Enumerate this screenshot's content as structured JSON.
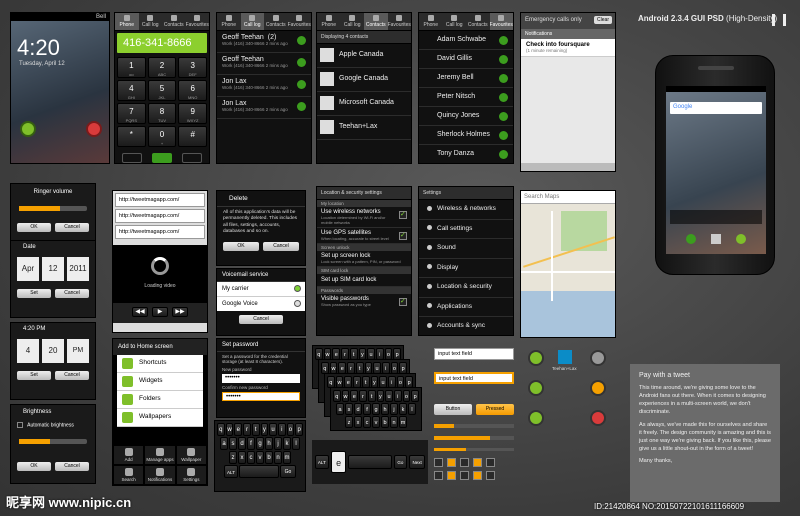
{
  "lock": {
    "carrier": "Bell",
    "time": "4:20",
    "date": "Tuesday, April 12"
  },
  "dialer": {
    "tabs": [
      "Phone",
      "Call log",
      "Contacts",
      "Favourites"
    ],
    "number": "416-341-8666",
    "keys": [
      [
        "1",
        "2",
        "3"
      ],
      [
        "4",
        "5",
        "6"
      ],
      [
        "7",
        "8",
        "9"
      ],
      [
        "*",
        "0",
        "#"
      ]
    ],
    "subs": [
      [
        "oo",
        "ABC",
        "DEF"
      ],
      [
        "GHI",
        "JKL",
        "MNO"
      ],
      [
        "PQRS",
        "TUV",
        "WXYZ"
      ],
      [
        "",
        "+",
        ""
      ]
    ]
  },
  "calllog": {
    "tabs": [
      "Phone",
      "Call log",
      "Contacts",
      "Favourites"
    ],
    "entries": [
      {
        "name": "Geoff Teehan",
        "count": "(2)",
        "detail": "Work (416) 340-8666 2 mins ago"
      },
      {
        "name": "Geoff Teehan",
        "count": "",
        "detail": "Work (416) 340-8666 2 mins ago"
      },
      {
        "name": "Jon Lax",
        "count": "",
        "detail": "Work (416) 340-8666 2 mins ago"
      },
      {
        "name": "Jon Lax",
        "count": "",
        "detail": "Work (416) 340-8666 2 mins ago"
      }
    ]
  },
  "contacts": {
    "tabs": [
      "Phone",
      "Call log",
      "Contacts",
      "Favourites"
    ],
    "header": "Displaying 4 contacts",
    "entries": [
      "Apple Canada",
      "Google Canada",
      "Microsoft Canada",
      "Teehan+Lax"
    ]
  },
  "favourites": {
    "tabs": [
      "Phone",
      "Call log",
      "Contacts",
      "Favourites"
    ],
    "entries": [
      "Adam Schwabe",
      "David Gillis",
      "Jeremy Bell",
      "Peter Nitsch",
      "Quincy Jones",
      "Sherlock Holmes",
      "Tony Danza"
    ]
  },
  "notif": {
    "bar": "Emergency calls only",
    "clear": "Clear",
    "section": "Notifications",
    "item": "Check into foursquare",
    "itemsub": "(1 minute remaining)"
  },
  "title": {
    "main": "Android 2.3.4 GUI PSD",
    "variant": "(High-Density)"
  },
  "ringer": {
    "label": "Ringer volume",
    "ok": "OK",
    "cancel": "Cancel"
  },
  "date": {
    "label": "Date",
    "month": "Apr",
    "day": "12",
    "year": "2011",
    "set": "Set",
    "cancel": "Cancel"
  },
  "time": {
    "label": "4:20 PM",
    "hour": "4",
    "minute": "20",
    "ampm": "PM",
    "set": "Set",
    "cancel": "Cancel"
  },
  "brightness": {
    "label": "Brightness",
    "auto": "Automatic brightness",
    "ok": "OK",
    "cancel": "Cancel"
  },
  "browser": {
    "url": "http://tweetmagapp.com/",
    "url2": "http://tweetmagapp.com/",
    "url3": "http://tweetmagapp.com/",
    "loading": "Loading video"
  },
  "home": {
    "title": "Add to Home screen",
    "items": [
      "Shortcuts",
      "Widgets",
      "Folders",
      "Wallpapers"
    ],
    "menu": [
      "Add",
      "Manage apps",
      "Wallpaper",
      "Search",
      "Notifications",
      "Settings"
    ]
  },
  "delete": {
    "title": "Delete",
    "body": "All of this application's data will be permanently deleted. This includes all files, settings, accounts, databases and so on.",
    "ok": "OK",
    "cancel": "Cancel"
  },
  "voicemail": {
    "title": "Voicemail service",
    "opt1": "My carrier",
    "opt2": "Google Voice",
    "cancel": "Cancel"
  },
  "password": {
    "title": "Set password",
    "body": "Set a password for the credential storage (at least 8 characters).",
    "new": "New password",
    "confirm": "Confirm new password",
    "value": "•••••••"
  },
  "location": {
    "header": "Location & security settings",
    "section": "My location",
    "items": [
      {
        "t": "Use wireless networks",
        "s": "Location determined by Wi-Fi and/or mobile networks"
      },
      {
        "t": "Use GPS satellites",
        "s": "When locating, accurate to street level"
      }
    ],
    "section2": "Screen unlock",
    "item3": "Set up screen lock",
    "item3s": "Lock screen with a pattern, PIN, or password",
    "section3": "SIM card lock",
    "item4": "Set up SIM card lock",
    "section4": "Passwords",
    "item5": "Visible passwords",
    "item5s": "Show password as you type"
  },
  "settings": {
    "header": "Settings",
    "items": [
      "Wireless & networks",
      "Call settings",
      "Sound",
      "Display",
      "Location & security",
      "Applications",
      "Accounts & sync"
    ]
  },
  "map": {
    "search": "Search Maps"
  },
  "keyboard": {
    "rows": [
      [
        "q",
        "w",
        "e",
        "r",
        "t",
        "y",
        "u",
        "i",
        "o",
        "p"
      ],
      [
        "a",
        "s",
        "d",
        "f",
        "g",
        "h",
        "j",
        "k",
        "l"
      ],
      [
        "z",
        "x",
        "c",
        "v",
        "b",
        "n",
        "m"
      ]
    ],
    "go": "Go",
    "alt": "ALT",
    "next": "Next"
  },
  "inputs": {
    "field1": "input text field",
    "field2": "input text field",
    "btn1": "Button",
    "btn2": "Pressed"
  },
  "tweet": {
    "heading": "Pay with a tweet",
    "p1": "This time around, we're giving some love to the Android fans out there. When it comes to designing experiences in a multi-screen world, we don't discriminate.",
    "p2": "As always, we've made this for ourselves and share it freely. The design community is amazing and this is just one way we're giving back. If you like this, please give us a little shout-out in the form of a tweet!",
    "thanks": "Many thanks,"
  },
  "phone": {
    "search": "Google"
  },
  "small": {
    "teehan": "Teehan+Lax"
  },
  "watermark": {
    "left": "昵享网 www.nipic.cn",
    "right": "ID:21420864 NO:20150722101611166609"
  }
}
